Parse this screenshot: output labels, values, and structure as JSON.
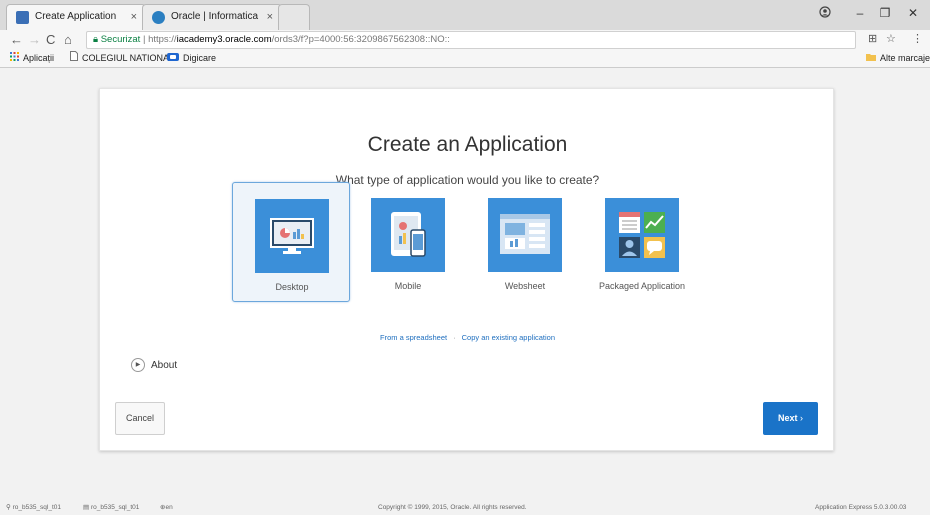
{
  "browser": {
    "tabs": [
      {
        "title": "Create Application",
        "close": "×"
      },
      {
        "title": "Oracle | Informatica",
        "close": "×"
      }
    ],
    "window_controls": {
      "minimize": "–",
      "maximize": "❐",
      "close": "✕"
    },
    "account_icon": "profile-icon",
    "address": {
      "secure_label": "Securizat",
      "separator": "|",
      "scheme": "https://",
      "host": "iacademy3.oracle.com",
      "path": "/ords3/f?p=4000:56:3209867562308::NO::"
    },
    "bookmarks": [
      {
        "label": "Aplicații",
        "icon": "apps-grid-icon"
      },
      {
        "label": "COLEGIUL NATIONAL",
        "icon": "page-icon"
      },
      {
        "label": "Digicare",
        "icon": "digicare-icon"
      }
    ],
    "other_bookmarks": "Alte marcaje"
  },
  "dialog": {
    "title": "Create an Application",
    "subtitle": "What type of application would you like to create?",
    "choices": [
      {
        "label": "Desktop",
        "icon": "desktop-icon",
        "selected": true
      },
      {
        "label": "Mobile",
        "icon": "mobile-icon",
        "selected": false
      },
      {
        "label": "Websheet",
        "icon": "websheet-icon",
        "selected": false
      },
      {
        "label": "Packaged Application",
        "icon": "packaged-application-icon",
        "selected": false
      }
    ],
    "links": {
      "from_spreadsheet": "From a spreadsheet",
      "separator": "·",
      "copy_existing": "Copy an existing application"
    },
    "about": "About",
    "cancel": "Cancel",
    "next": "Next",
    "accent": "#1a73c8",
    "tile_color": "#3b8fd9"
  },
  "footer": {
    "user1": "ro_b535_sql_t01",
    "user2": "ro_b535_sql_t01",
    "lang": "en",
    "copyright": "Copyright © 1999, 2015, Oracle. All rights reserved.",
    "version": "Application Express 5.0.3.00.03"
  }
}
